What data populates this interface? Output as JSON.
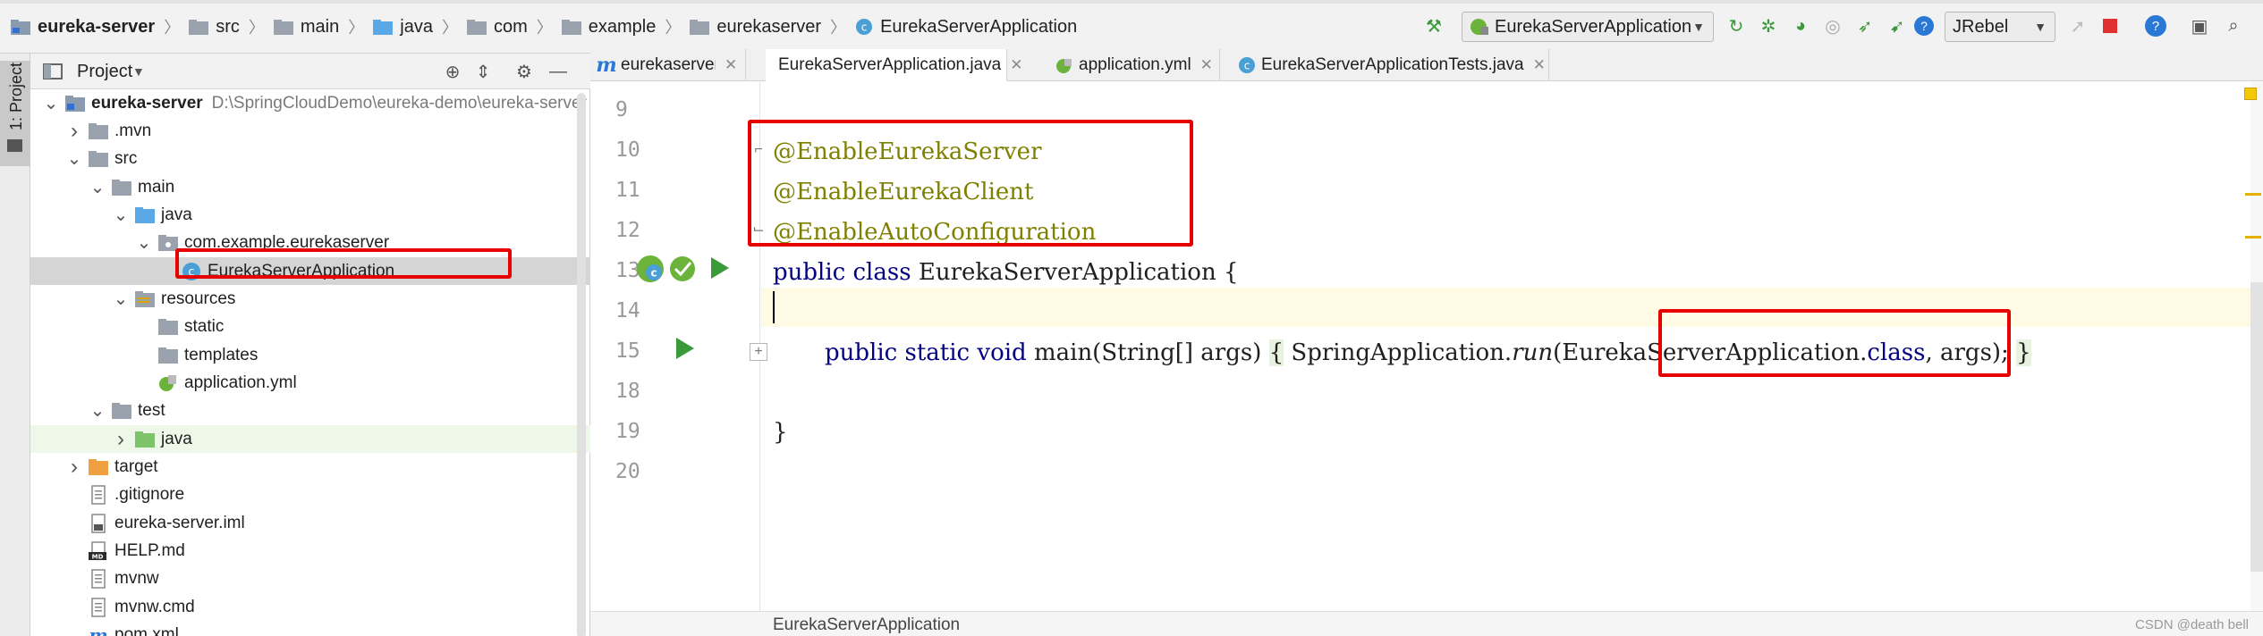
{
  "breadcrumbs": [
    "eureka-server",
    "src",
    "main",
    "java",
    "com",
    "example",
    "eurekaserver",
    "EurekaServerApplication"
  ],
  "toolbar": {
    "run_config": "EurekaServerApplication",
    "jrebel": "JRebel",
    "icons": [
      "hammer-icon",
      "rerun-icon",
      "debug-icon",
      "coverage-icon",
      "profile-icon",
      "jrebel-run-icon",
      "jrebel-debug-icon",
      "help-icon",
      "stop-icon",
      "update-icon",
      "project-structure-icon",
      "search-everywhere-icon"
    ]
  },
  "side_tab": {
    "label": "1: Project"
  },
  "project_panel": {
    "title": "Project",
    "tree": [
      {
        "label": "eureka-server",
        "path": "D:\\SpringCloudDemo\\eureka-demo\\eureka-server",
        "icon": "module-folder-icon",
        "arrow": "down",
        "depth": 0,
        "bold": true
      },
      {
        "label": ".mvn",
        "icon": "folder-icon",
        "arrow": "right",
        "depth": 1
      },
      {
        "label": "src",
        "icon": "folder-icon",
        "arrow": "down",
        "depth": 1
      },
      {
        "label": "main",
        "icon": "folder-icon",
        "arrow": "down",
        "depth": 2
      },
      {
        "label": "java",
        "icon": "source-folder-icon",
        "arrow": "down",
        "depth": 3
      },
      {
        "label": "com.example.eurekaserver",
        "icon": "package-icon",
        "arrow": "down",
        "depth": 4
      },
      {
        "label": "EurekaServerApplication",
        "icon": "spring-class-icon",
        "arrow": "",
        "depth": 5,
        "selected": true
      },
      {
        "label": "resources",
        "icon": "resources-folder-icon",
        "arrow": "down",
        "depth": 3
      },
      {
        "label": "static",
        "icon": "folder-icon",
        "arrow": "",
        "depth": 4
      },
      {
        "label": "templates",
        "icon": "folder-icon",
        "arrow": "",
        "depth": 4
      },
      {
        "label": "application.yml",
        "icon": "yml-file-icon",
        "arrow": "",
        "depth": 4
      },
      {
        "label": "test",
        "icon": "folder-icon",
        "arrow": "down",
        "depth": 2
      },
      {
        "label": "java",
        "icon": "test-folder-icon",
        "arrow": "right",
        "depth": 3,
        "test": true
      },
      {
        "label": "target",
        "icon": "excluded-folder-icon",
        "arrow": "right",
        "depth": 1
      },
      {
        "label": ".gitignore",
        "icon": "text-file-icon",
        "arrow": "",
        "depth": 1
      },
      {
        "label": "eureka-server.iml",
        "icon": "iml-file-icon",
        "arrow": "",
        "depth": 1
      },
      {
        "label": "HELP.md",
        "icon": "markdown-file-icon",
        "arrow": "",
        "depth": 1
      },
      {
        "label": "mvnw",
        "icon": "text-file-icon",
        "arrow": "",
        "depth": 1
      },
      {
        "label": "mvnw.cmd",
        "icon": "text-file-icon",
        "arrow": "",
        "depth": 1
      },
      {
        "label": "pom.xml",
        "icon": "maven-file-icon",
        "arrow": "",
        "depth": 1
      }
    ]
  },
  "tabs": [
    {
      "label": "eurekaserver",
      "icon": "maven-m-icon"
    },
    {
      "label": "EurekaServerApplication.java",
      "icon": "spring-class-icon",
      "active": true
    },
    {
      "label": "application.yml",
      "icon": "yml-file-icon"
    },
    {
      "label": "EurekaServerApplicationTests.java",
      "icon": "class-icon"
    }
  ],
  "editor": {
    "line_numbers": [
      "9",
      "10",
      "11",
      "12",
      "13",
      "14",
      "15",
      "18",
      "19",
      "20"
    ],
    "lines": {
      "l10": "@EnableEurekaServer",
      "l11": "@EnableEurekaClient",
      "l12": "@EnableAutoConfiguration",
      "l13_kw1": "public",
      "l13_kw2": "class",
      "l13_rest": " EurekaServerApplication {",
      "l15_kw1": "public",
      "l15_kw2": "static",
      "l15_kw3": "void",
      "l15_a": " main(String[] args) ",
      "l15_open": "{",
      "l15_b": " SpringApplication.",
      "l15_run": "run",
      "l15_c": "(EurekaServerApplication.",
      "l15_class": "class",
      "l15_d": ", args); ",
      "l15_close": "}",
      "l19": "}"
    }
  },
  "status": {
    "breadcrumb": "EurekaServerApplication"
  },
  "watermark": "CSDN @death bell",
  "colors": {
    "keyword": "#000080",
    "annotation": "#808000",
    "highlight_box": "#e60000",
    "selection": "#d5d5d5",
    "current_line": "#fffae3"
  }
}
